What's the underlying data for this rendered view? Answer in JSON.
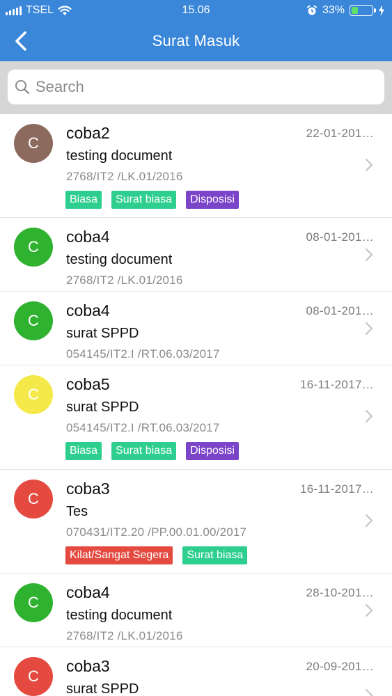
{
  "status_bar": {
    "carrier": "TSEL",
    "time": "15.06",
    "battery_percent": "33%",
    "battery_level": 0.33
  },
  "nav": {
    "title": "Surat Masuk",
    "back_icon": "chevron-left-icon"
  },
  "search": {
    "placeholder": "Search",
    "value": ""
  },
  "colors": {
    "header_blue": "#3a87d9",
    "tag_green": "#2ecf8e",
    "tag_purple": "#7b44c9",
    "tag_red": "#e44a3f",
    "avatar_brown": "#8d6a5e",
    "avatar_green": "#2fb22f",
    "avatar_yellow": "#f5e94a",
    "avatar_red": "#e44a3f"
  },
  "items": [
    {
      "initial": "C",
      "avatar_color": "#8d6a5e",
      "sender": "coba2",
      "date": "22-01-201…",
      "subject": "testing document",
      "number": "2768/IT2 /LK.01/2016",
      "tags": [
        {
          "label": "Biasa",
          "color": "#2ecf8e"
        },
        {
          "label": "Surat biasa",
          "color": "#2ecf8e"
        },
        {
          "label": "Disposisi",
          "color": "#7b44c9"
        }
      ]
    },
    {
      "initial": "C",
      "avatar_color": "#2fb22f",
      "sender": "coba4",
      "date": "08-01-201…",
      "subject": "testing document",
      "number": "2768/IT2 /LK.01/2016",
      "tags": []
    },
    {
      "initial": "C",
      "avatar_color": "#2fb22f",
      "sender": "coba4",
      "date": "08-01-201…",
      "subject": "surat SPPD",
      "number": "054145/IT2.I /RT.06.03/2017",
      "tags": []
    },
    {
      "initial": "C",
      "avatar_color": "#f5e94a",
      "sender": "coba5",
      "date": "16-11-2017…",
      "subject": "surat SPPD",
      "number": "054145/IT2.I /RT.06.03/2017",
      "tags": [
        {
          "label": "Biasa",
          "color": "#2ecf8e"
        },
        {
          "label": "Surat biasa",
          "color": "#2ecf8e"
        },
        {
          "label": "Disposisi",
          "color": "#7b44c9"
        }
      ]
    },
    {
      "initial": "C",
      "avatar_color": "#e44a3f",
      "sender": "coba3",
      "date": "16-11-2017…",
      "subject": "Tes",
      "number": "070431/IT2.20 /PP.00.01.00/2017",
      "tags": [
        {
          "label": "Kilat/Sangat Segera",
          "color": "#e44a3f"
        },
        {
          "label": "Surat biasa",
          "color": "#2ecf8e"
        }
      ]
    },
    {
      "initial": "C",
      "avatar_color": "#2fb22f",
      "sender": "coba4",
      "date": "28-10-201…",
      "subject": "testing document",
      "number": "2768/IT2 /LK.01/2016",
      "tags": []
    },
    {
      "initial": "C",
      "avatar_color": "#e44a3f",
      "sender": "coba3",
      "date": "20-09-201…",
      "subject": "surat SPPD",
      "number": "",
      "tags": []
    }
  ]
}
